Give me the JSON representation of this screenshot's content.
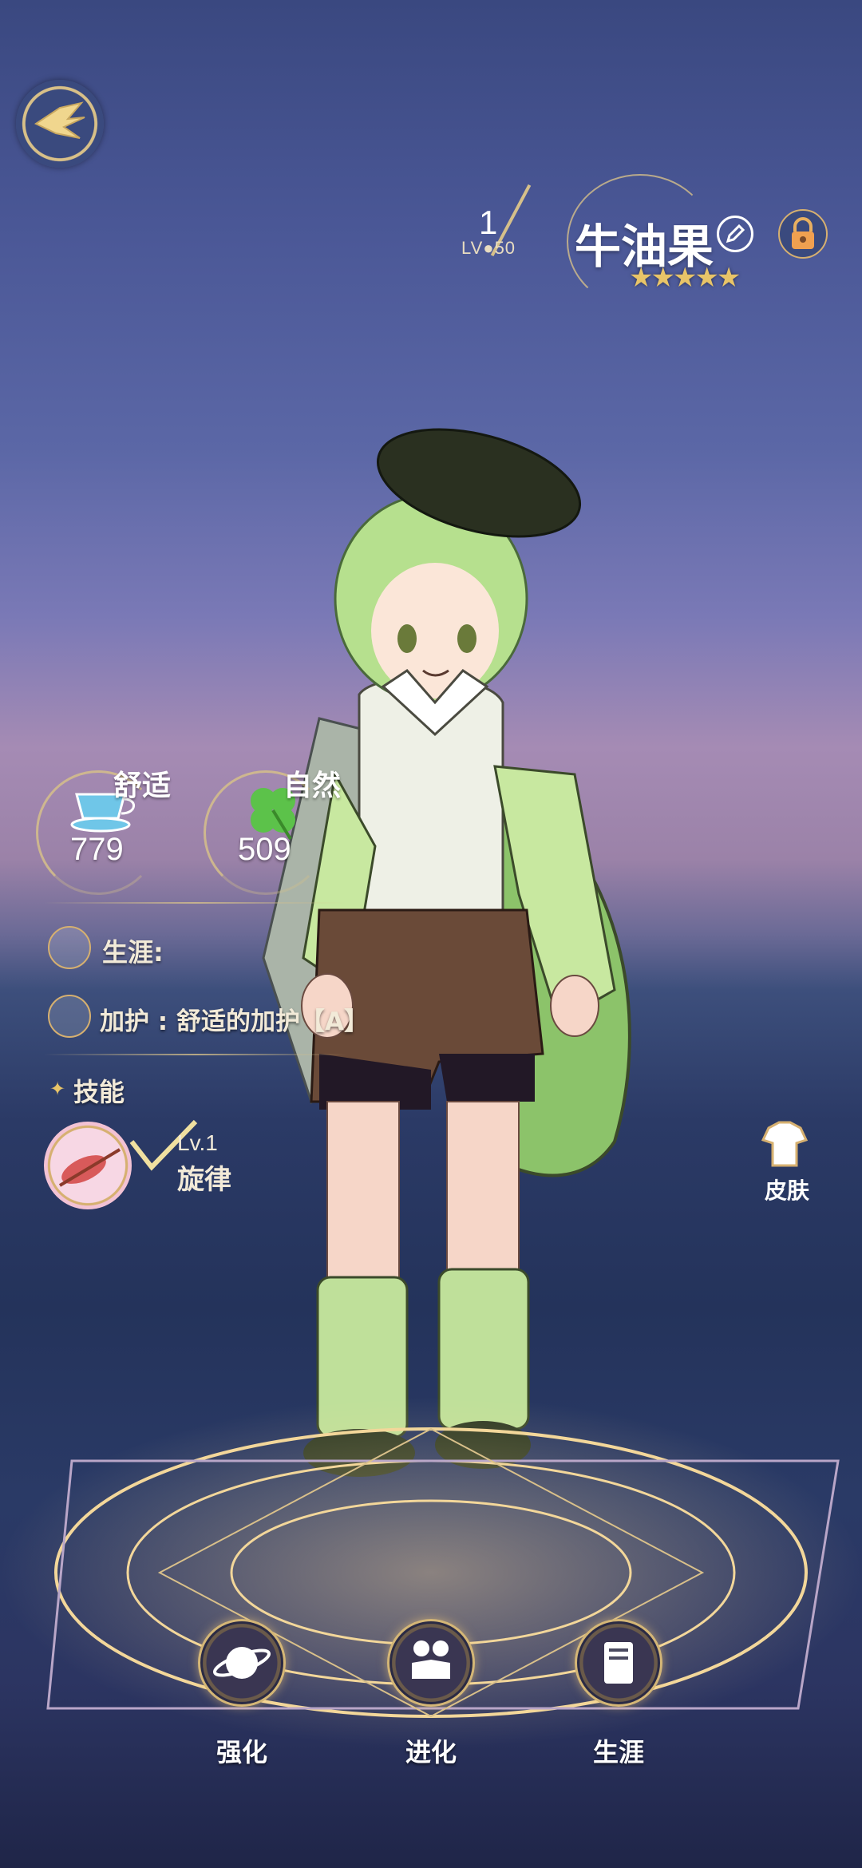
{
  "header": {
    "level_current": "1",
    "level_cap": "LV●50",
    "character_name": "牛油果",
    "stars": "★★★★★",
    "star_count": 5
  },
  "stats": [
    {
      "label": "舒适",
      "value": "779",
      "icon": "teacup-icon"
    },
    {
      "label": "自然",
      "value": "509",
      "icon": "clover-icon"
    }
  ],
  "career": {
    "label": "生涯:"
  },
  "blessing": {
    "label": "加护 : 舒适的加护【A】"
  },
  "skills": {
    "title": "技能",
    "items": [
      {
        "level": "Lv.1",
        "name": "旋律",
        "icon": "violin-icon"
      }
    ]
  },
  "skin": {
    "label": "皮肤"
  },
  "bottom_nav": [
    {
      "label": "强化",
      "icon": "planet-icon"
    },
    {
      "label": "进化",
      "icon": "figures-icon"
    },
    {
      "label": "生涯",
      "icon": "scroll-icon"
    }
  ],
  "colors": {
    "gold_accent": "#d6c08a",
    "star": "#e8c468",
    "clover": "#5cc24a",
    "teacup": "#6fc6e8"
  }
}
